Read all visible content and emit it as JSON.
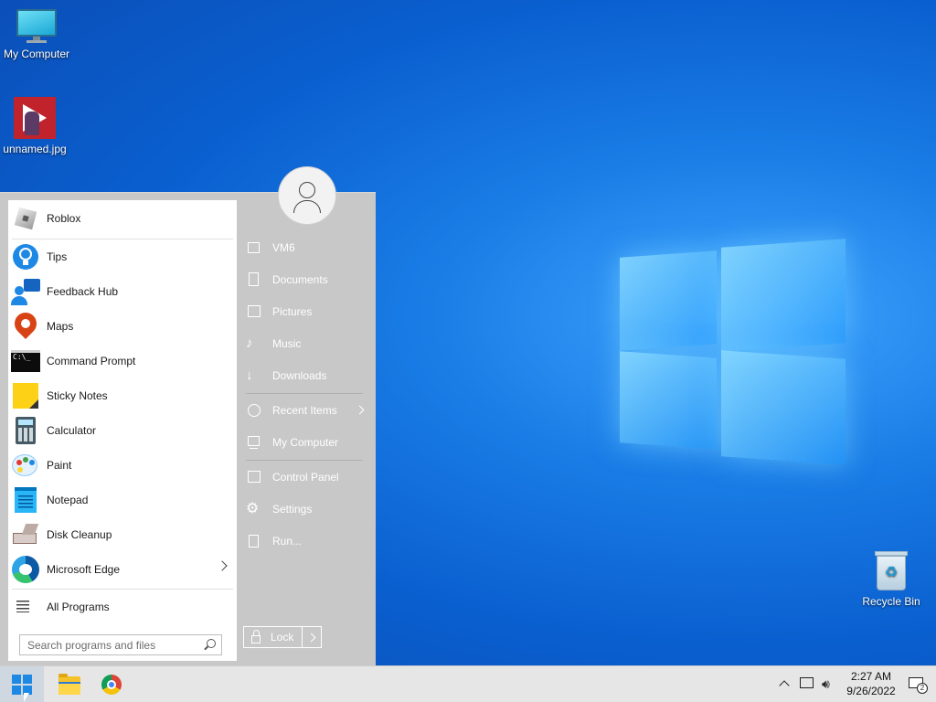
{
  "desktop": {
    "icons": [
      {
        "label": "My Computer"
      },
      {
        "label": "unnamed.jpg"
      },
      {
        "label": "Recycle Bin"
      }
    ]
  },
  "start_menu": {
    "programs": [
      {
        "label": "Roblox",
        "icon": "roblox-icon"
      },
      {
        "label": "Tips",
        "icon": "lightbulb-icon"
      },
      {
        "label": "Feedback Hub",
        "icon": "feedback-hub-icon"
      },
      {
        "label": "Maps",
        "icon": "map-pin-icon"
      },
      {
        "label": "Command Prompt",
        "icon": "terminal-icon",
        "icon_text": "C:\\_"
      },
      {
        "label": "Sticky Notes",
        "icon": "sticky-note-icon"
      },
      {
        "label": "Calculator",
        "icon": "calculator-icon"
      },
      {
        "label": "Paint",
        "icon": "palette-icon"
      },
      {
        "label": "Notepad",
        "icon": "notepad-icon"
      },
      {
        "label": "Disk Cleanup",
        "icon": "disk-cleanup-icon"
      },
      {
        "label": "Microsoft Edge",
        "icon": "edge-icon"
      }
    ],
    "all_programs": "All Programs",
    "search_placeholder": "Search programs and files",
    "places": [
      {
        "label": "VM6",
        "icon": "user-folder-icon"
      },
      {
        "label": "Documents",
        "icon": "document-icon"
      },
      {
        "label": "Pictures",
        "icon": "picture-icon"
      },
      {
        "label": "Music",
        "icon": "music-note-icon"
      },
      {
        "label": "Downloads",
        "icon": "download-icon"
      },
      {
        "label": "Recent Items",
        "icon": "clock-icon"
      },
      {
        "label": "My Computer",
        "icon": "computer-icon"
      },
      {
        "label": "Control Panel",
        "icon": "control-panel-icon"
      },
      {
        "label": "Settings",
        "icon": "gear-icon"
      },
      {
        "label": "Run...",
        "icon": "run-icon"
      }
    ],
    "lock_label": "Lock"
  },
  "taskbar": {
    "time": "2:27 AM",
    "date": "9/26/2022",
    "notification_count": "2"
  },
  "colors": {
    "desktop_blue": "#0a5fcf",
    "start_menu_gray": "#c8c8c8",
    "taskbar": "#e6e6e6"
  }
}
